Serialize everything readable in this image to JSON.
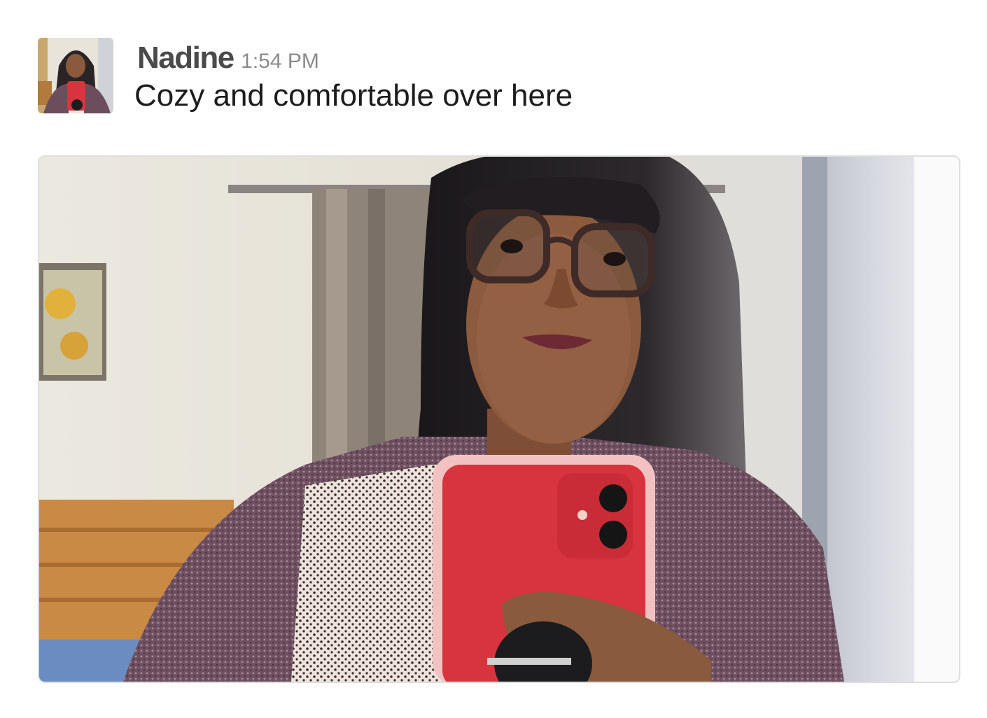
{
  "message": {
    "author": "Nadine",
    "timestamp": "1:54 PM",
    "text": "Cozy and comfortable over here"
  },
  "avatar": {
    "icon": "user-avatar-photo"
  },
  "attachment": {
    "type": "image",
    "icon": "photo-selfie",
    "colors": {
      "wall": "#e9e6dd",
      "phone_case": "#d8343d",
      "jacket": "#6b4d5c",
      "hair": "#1e1b1e"
    }
  }
}
